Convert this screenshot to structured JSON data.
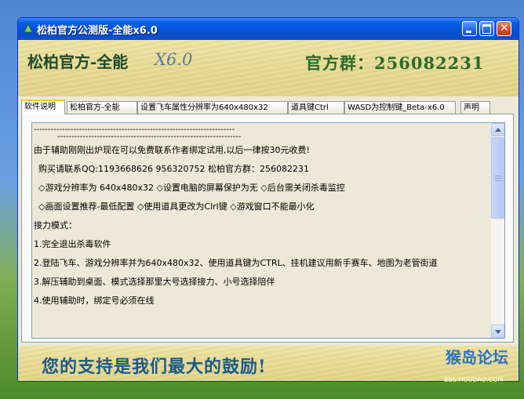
{
  "window": {
    "title": "松柏官方公测版-全能x6.0"
  },
  "banner": {
    "brand": "松柏官方-全能",
    "version": "X6.0",
    "qq_group": "官方群：256082231"
  },
  "tabs": [
    {
      "label": "软件说明",
      "active": true
    },
    {
      "label": "松柏官方-全能",
      "active": false
    },
    {
      "label": "设置飞车属性分辨率为640x480x32",
      "active": false
    },
    {
      "label": "道具键Ctrl",
      "active": false
    },
    {
      "label": "WASD为控制键_Beta-x6.0",
      "active": false
    },
    {
      "label": "声明",
      "active": false
    }
  ],
  "content": {
    "lines": [
      "-----------------------------------------------------------------------",
      "-----------------------------------------------------------------",
      "由于辅助刚刚出炉现在可以免费联系作者绑定试用,以后一律按30元收费!",
      "购买请联系QQ:1193668626  956320752     松柏官方群：256082231",
      "◇游戏分辨率为 640x480x32    ◇设置电脑的屏幕保护为无     ◇后台需关闭杀毒监控",
      "◇画面设置推荐-最低配置        ◇使用道具更改为Clrl键           ◇游戏窗口不能最小化",
      "接力模式：",
      "1.完全退出杀毒软件",
      "2.登陆飞车、游戏分辨率并为640x480x32、使用道具键为CTRL、挂机建议用新手赛车、地图为老管街道",
      "3.解压辅助到桌面、模式选择那里大号选择接力、小号选择陪伴",
      "4.使用辅助时，绑定号必须在线"
    ]
  },
  "footer": {
    "slogan": "您的支持是我们最大的鼓励!",
    "watermark_logo": "猴岛论坛",
    "watermark_url": "BBS.HOUDAO.COM"
  },
  "colors": {
    "titlebar": "#0554d8",
    "window_bg": "#ece9d8",
    "wood": "#e8dc95"
  }
}
